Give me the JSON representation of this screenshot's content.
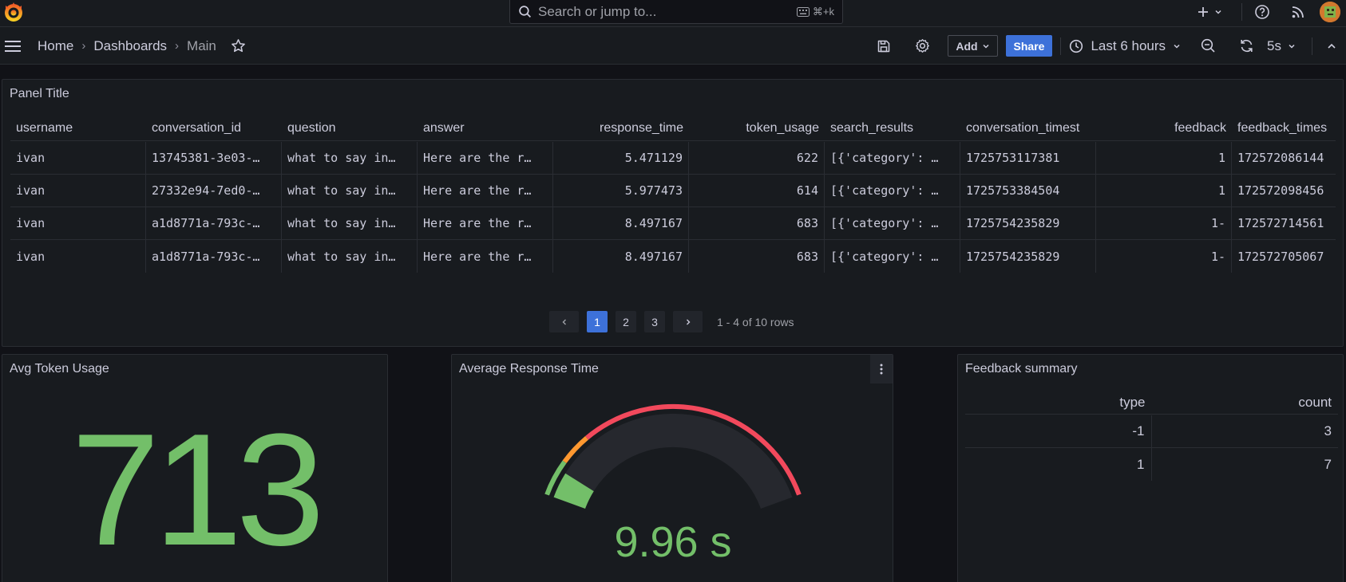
{
  "search": {
    "placeholder": "Search or jump to...",
    "shortcut": "⌘+k"
  },
  "breadcrumb": {
    "home": "Home",
    "dashboards": "Dashboards",
    "current": "Main"
  },
  "toolbar": {
    "add_label": "Add",
    "share_label": "Share",
    "time_range": "Last 6 hours",
    "refresh_interval": "5s"
  },
  "table_panel": {
    "title": "Panel Title",
    "columns": [
      "username",
      "conversation_id",
      "question",
      "answer",
      "response_time",
      "token_usage",
      "search_results",
      "conversation_timest",
      "feedback",
      "feedback_times"
    ],
    "rows": [
      [
        "ivan",
        "13745381-3e03-…",
        "what to say in…",
        "Here are the r…",
        "5.471129",
        "622",
        "[{'category': …",
        "1725753117381",
        "1",
        "172572086144"
      ],
      [
        "ivan",
        "27332e94-7ed0-…",
        "what to say in…",
        "Here are the r…",
        "5.977473",
        "614",
        "[{'category': …",
        "1725753384504",
        "1",
        "172572098456"
      ],
      [
        "ivan",
        "a1d8771a-793c-…",
        "what to say in…",
        "Here are the r…",
        "8.497167",
        "683",
        "[{'category': …",
        "1725754235829",
        "1-",
        "172572714561"
      ],
      [
        "ivan",
        "a1d8771a-793c-…",
        "what to say in…",
        "Here are the r…",
        "8.497167",
        "683",
        "[{'category': …",
        "1725754235829",
        "1-",
        "172572705067"
      ]
    ],
    "pagination": {
      "pages": [
        "1",
        "2",
        "3"
      ],
      "current": "1",
      "summary": "1 - 4 of 10 rows"
    }
  },
  "stat_panel": {
    "title": "Avg Token Usage",
    "value": "713",
    "color": "#73bf69"
  },
  "gauge_panel": {
    "title": "Average Response Time",
    "value_text": "9.96 s",
    "value": 9.96,
    "min": 0,
    "max": 10,
    "colors": {
      "green": "#73bf69",
      "orange": "#ff9830",
      "red": "#f2495c"
    }
  },
  "feedback_panel": {
    "title": "Feedback summary",
    "columns": [
      "type",
      "count"
    ],
    "rows": [
      [
        "-1",
        "3"
      ],
      [
        "1",
        "7"
      ]
    ]
  }
}
